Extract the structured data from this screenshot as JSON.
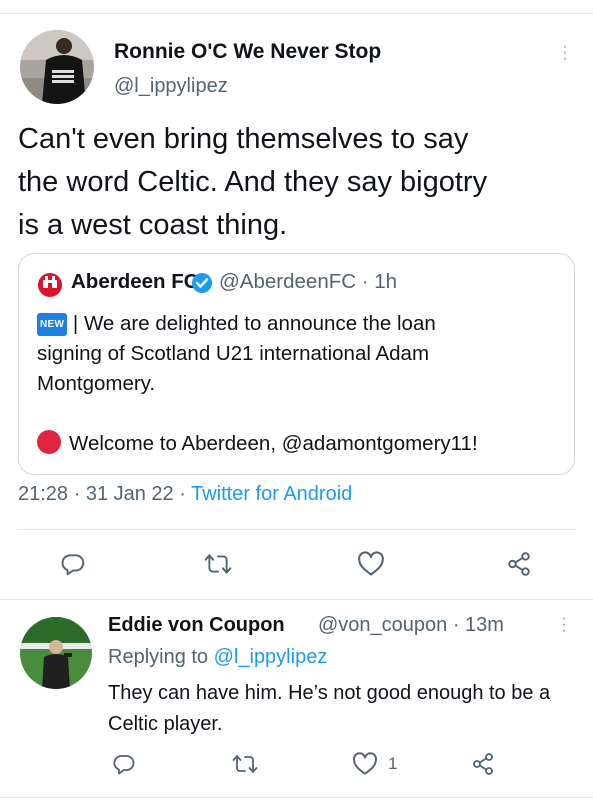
{
  "tweet": {
    "author_name": "Ronnie O'C We Never Stop",
    "author_handle": "@l_ippylipez",
    "text_lines": [
      "Can't even bring themselves to say",
      "the word Celtic. And they say bigotry",
      "is a west coast thing."
    ],
    "meta_time": "21:28 · 31 Jan 22 · ",
    "meta_source": "Twitter for Android"
  },
  "quote": {
    "name": "Aberdeen FC",
    "handle_time": "@AberdeenFC · 1h",
    "badge": "NEW",
    "line1": " | We are delighted to announce the loan",
    "line2": "signing of Scotland U21 international Adam",
    "line3": "Montgomery.",
    "welcome_text": "Welcome to Aberdeen, @adamontgomery11!"
  },
  "reply": {
    "author_name": "Eddie von Coupon",
    "handle_time": "@von_coupon · 13m",
    "replying_label": "Replying to ",
    "replying_handle": "@l_ippylipez",
    "text": "They can have him. He’s not good enough to be a Celtic player.",
    "like_count": "1"
  },
  "colors": {
    "accent": "#1d9bf0",
    "muted": "#536471",
    "text": "#0f1419",
    "red_dot": "#e0263e",
    "verified": "#1d9bf0",
    "new_badge": "#1d7fe0"
  },
  "icons": [
    "more-icon",
    "reply-icon",
    "retweet-icon",
    "like-icon",
    "share-icon",
    "verified-icon",
    "red-circle-icon",
    "new-badge-icon",
    "aberdeen-crest-icon"
  ]
}
